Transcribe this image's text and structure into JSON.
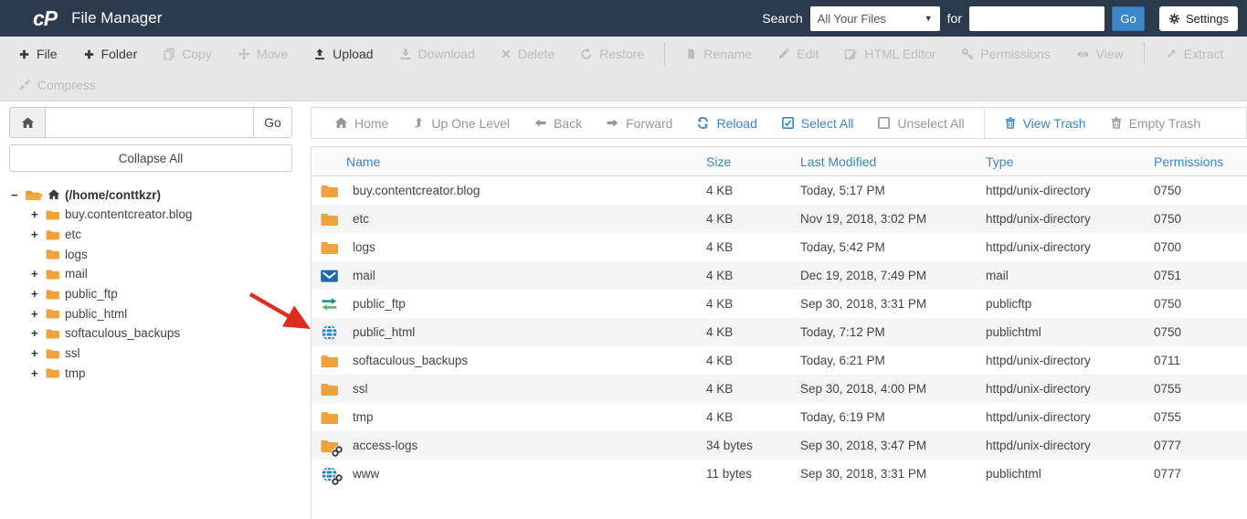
{
  "header": {
    "logo": "cP",
    "title": "File Manager",
    "search_label": "Search",
    "search_scope_selected": "All Your Files",
    "for_label": "for",
    "search_value": "",
    "go_label": "Go",
    "settings_label": "Settings"
  },
  "toolbar": {
    "file": "File",
    "folder": "Folder",
    "copy": "Copy",
    "move": "Move",
    "upload": "Upload",
    "download": "Download",
    "delete": "Delete",
    "restore": "Restore",
    "rename": "Rename",
    "edit": "Edit",
    "html_editor": "HTML Editor",
    "permissions": "Permissions",
    "view": "View",
    "extract": "Extract",
    "compress": "Compress"
  },
  "navbar": {
    "home": "Home",
    "up_one_level": "Up One Level",
    "back": "Back",
    "forward": "Forward",
    "reload": "Reload",
    "select_all": "Select All",
    "unselect_all": "Unselect All",
    "view_trash": "View Trash",
    "empty_trash": "Empty Trash"
  },
  "sidebar": {
    "path_value": "",
    "go_label": "Go",
    "collapse_all_label": "Collapse All",
    "root_label": "(/home/conttkzr)",
    "root_expander": "−",
    "items": [
      {
        "expander": "+",
        "label": "buy.contentcreator.blog"
      },
      {
        "expander": "+",
        "label": "etc"
      },
      {
        "expander": "",
        "label": "logs"
      },
      {
        "expander": "+",
        "label": "mail"
      },
      {
        "expander": "+",
        "label": "public_ftp"
      },
      {
        "expander": "+",
        "label": "public_html"
      },
      {
        "expander": "+",
        "label": "softaculous_backups"
      },
      {
        "expander": "+",
        "label": "ssl"
      },
      {
        "expander": "+",
        "label": "tmp"
      }
    ]
  },
  "table": {
    "headers": {
      "name": "Name",
      "size": "Size",
      "modified": "Last Modified",
      "type": "Type",
      "permissions": "Permissions"
    },
    "rows": [
      {
        "name": "buy.contentcreator.blog",
        "size": "4 KB",
        "modified": "Today, 5:17 PM",
        "type": "httpd/unix-directory",
        "perms": "0750",
        "icon": "#sym-folder",
        "link": ""
      },
      {
        "name": "etc",
        "size": "4 KB",
        "modified": "Nov 19, 2018, 3:02 PM",
        "type": "httpd/unix-directory",
        "perms": "0750",
        "icon": "#sym-folder",
        "link": ""
      },
      {
        "name": "logs",
        "size": "4 KB",
        "modified": "Today, 5:42 PM",
        "type": "httpd/unix-directory",
        "perms": "0700",
        "icon": "#sym-folder",
        "link": ""
      },
      {
        "name": "mail",
        "size": "4 KB",
        "modified": "Dec 19, 2018, 7:49 PM",
        "type": "mail",
        "perms": "0751",
        "icon": "#sym-envelope",
        "link": ""
      },
      {
        "name": "public_ftp",
        "size": "4 KB",
        "modified": "Sep 30, 2018, 3:31 PM",
        "type": "publicftp",
        "perms": "0750",
        "icon": "#sym-ftp",
        "link": ""
      },
      {
        "name": "public_html",
        "size": "4 KB",
        "modified": "Today, 7:12 PM",
        "type": "publichtml",
        "perms": "0750",
        "icon": "#sym-globe",
        "link": ""
      },
      {
        "name": "softaculous_backups",
        "size": "4 KB",
        "modified": "Today, 6:21 PM",
        "type": "httpd/unix-directory",
        "perms": "0711",
        "icon": "#sym-folder",
        "link": ""
      },
      {
        "name": "ssl",
        "size": "4 KB",
        "modified": "Sep 30, 2018, 4:00 PM",
        "type": "httpd/unix-directory",
        "perms": "0755",
        "icon": "#sym-folder",
        "link": ""
      },
      {
        "name": "tmp",
        "size": "4 KB",
        "modified": "Today, 6:19 PM",
        "type": "httpd/unix-directory",
        "perms": "0755",
        "icon": "#sym-folder",
        "link": ""
      },
      {
        "name": "access-logs",
        "size": "34 bytes",
        "modified": "Sep 30, 2018, 3:47 PM",
        "type": "httpd/unix-directory",
        "perms": "0777",
        "icon": "#sym-folder",
        "link": "has-link"
      },
      {
        "name": "www",
        "size": "11 bytes",
        "modified": "Sep 30, 2018, 3:31 PM",
        "type": "publichtml",
        "perms": "0777",
        "icon": "#sym-globe",
        "link": "has-link"
      }
    ]
  },
  "colors": {
    "header_bg": "#2b3a4d",
    "accent_blue": "#3a85c8",
    "folder_orange": "#efa23d",
    "annotation_arrow_red": "#e02b20",
    "toolbar_bg": "#e7e7e7"
  }
}
